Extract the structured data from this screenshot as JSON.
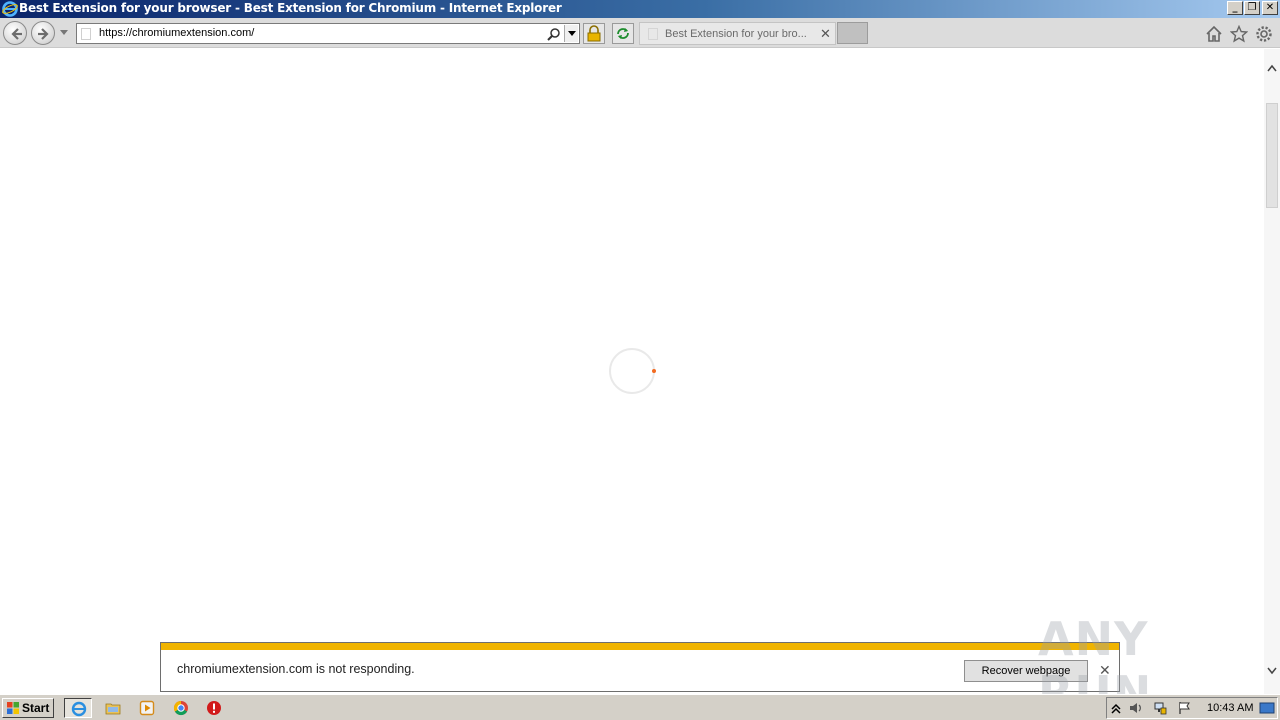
{
  "window": {
    "title": "Best Extension for your browser - Best Extension for Chromium - Internet Explorer",
    "minimize": "_",
    "restore": "❐",
    "close": "✕"
  },
  "toolbar": {
    "url": "https://chromiumextension.com/",
    "tab_title": "Best Extension for your bro...",
    "tab_close": "✕"
  },
  "notification": {
    "message": "chromiumextension.com is not responding.",
    "recover_button": "Recover webpage",
    "close": "✕"
  },
  "watermark": {
    "text": "ANY RUN"
  },
  "taskbar": {
    "start_label": "Start",
    "clock": "10:43 AM"
  },
  "colors": {
    "notification_stripe": "#f0b400",
    "spinner_dot": "#f26b21",
    "titlebar_start": "#0a246a"
  }
}
